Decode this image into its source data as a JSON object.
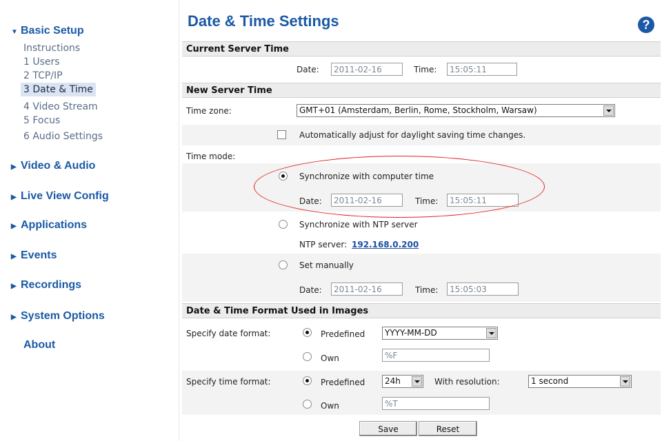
{
  "sidebar": {
    "basic_setup": "Basic Setup",
    "sub": [
      "Instructions",
      "1 Users",
      "2 TCP/IP",
      "3 Date & Time",
      "4 Video Stream",
      "5 Focus",
      "6 Audio Settings"
    ],
    "sections": [
      "Video & Audio",
      "Live View Config",
      "Applications",
      "Events",
      "Recordings",
      "System Options"
    ],
    "about": "About"
  },
  "title": "Date & Time Settings",
  "help": "?",
  "current": {
    "header": "Current Server Time",
    "date_label": "Date:",
    "date": "2011-02-16",
    "time_label": "Time:",
    "time": "15:05:11"
  },
  "newtime": {
    "header": "New Server Time",
    "timezone_label": "Time zone:",
    "timezone": "GMT+01 (Amsterdam, Berlin, Rome, Stockholm, Warsaw)",
    "dst_label": "Automatically adjust for daylight saving time changes.",
    "mode_label": "Time mode:",
    "sync_computer": "Synchronize with computer time",
    "date_label": "Date:",
    "time_label": "Time:",
    "c_date": "2011-02-16",
    "c_time": "15:05:11",
    "sync_ntp": "Synchronize with NTP server",
    "ntp_label": "NTP server:",
    "ntp_value": "192.168.0.200",
    "manual": "Set manually",
    "m_date": "2011-02-16",
    "m_time": "15:05:03"
  },
  "format": {
    "header": "Date & Time Format Used in Images",
    "date_label": "Specify date format:",
    "predefined": "Predefined",
    "own": "Own",
    "date_predef": "YYYY-MM-DD",
    "date_own": "%F",
    "time_label": "Specify time format:",
    "time_predef": "24h",
    "resolution_label": "With resolution:",
    "resolution": "1 second",
    "time_own": "%T"
  },
  "buttons": {
    "save": "Save",
    "reset": "Reset"
  }
}
